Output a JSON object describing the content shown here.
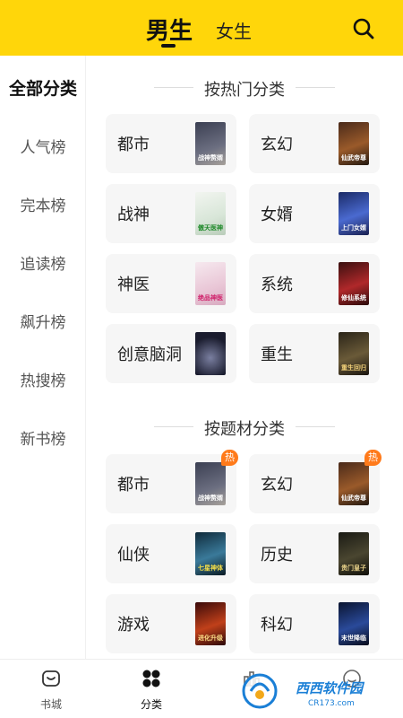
{
  "header": {
    "tab_male": "男生",
    "tab_female": "女生",
    "search_icon": "search-icon",
    "accent": "#FFD60A"
  },
  "sidebar": {
    "items": [
      {
        "label": "全部分类",
        "active": true
      },
      {
        "label": "人气榜"
      },
      {
        "label": "完本榜"
      },
      {
        "label": "追读榜"
      },
      {
        "label": "飙升榜"
      },
      {
        "label": "热搜榜"
      },
      {
        "label": "新书榜"
      }
    ]
  },
  "hot_section": {
    "title": "按热门分类",
    "cards": [
      {
        "label": "都市",
        "cover_text": "战神赘婿"
      },
      {
        "label": "玄幻",
        "cover_text": "仙武帝尊"
      },
      {
        "label": "战神",
        "cover_text": "傲天医神"
      },
      {
        "label": "女婿",
        "cover_text": "上门女婿"
      },
      {
        "label": "神医",
        "cover_text": "绝品神医"
      },
      {
        "label": "系统",
        "cover_text": "修仙系统"
      },
      {
        "label": "创意脑洞",
        "cover_text": ""
      },
      {
        "label": "重生",
        "cover_text": "重生回归"
      }
    ]
  },
  "topic_section": {
    "title": "按题材分类",
    "hot_badge": "热",
    "cards": [
      {
        "label": "都市",
        "cover_text": "战神赘婿",
        "hot": true
      },
      {
        "label": "玄幻",
        "cover_text": "仙武帝尊",
        "hot": true
      },
      {
        "label": "仙侠",
        "cover_text": "七星神体"
      },
      {
        "label": "历史",
        "cover_text": "贵门皇子"
      },
      {
        "label": "游戏",
        "cover_text": "进化升级"
      },
      {
        "label": "科幻",
        "cover_text": "末世降临"
      }
    ]
  },
  "bottom_nav": {
    "items": [
      {
        "label": "书城",
        "icon": "bookstore-icon"
      },
      {
        "label": "分类",
        "icon": "category-grid-icon",
        "active": true
      },
      {
        "label": "",
        "icon": "rank-icon"
      },
      {
        "label": "",
        "icon": "profile-icon"
      }
    ]
  },
  "watermark": {
    "brand": "西西软件园",
    "url": "CR173.com"
  }
}
